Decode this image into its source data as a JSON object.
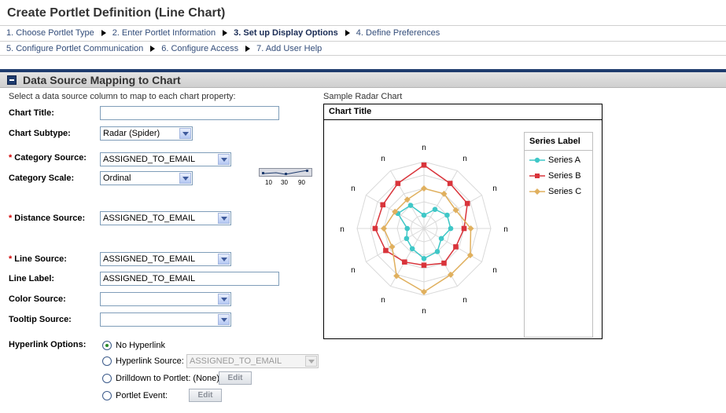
{
  "page": {
    "title": "Create Portlet Definition (Line Chart)"
  },
  "steps": [
    {
      "label": "1. Choose Portlet Type",
      "current": false
    },
    {
      "label": "2. Enter Portlet Information",
      "current": false
    },
    {
      "label": "3. Set up Display Options",
      "current": true
    },
    {
      "label": "4. Define Preferences",
      "current": false
    },
    {
      "label": "5. Configure Portlet Communication",
      "current": false
    },
    {
      "label": "6. Configure Access",
      "current": false
    },
    {
      "label": "7. Add User Help",
      "current": false
    }
  ],
  "section": {
    "title": "Data Source Mapping to Chart",
    "instructions": "Select a data source column to map to each chart property:",
    "sample_label": "Sample Radar Chart"
  },
  "form": {
    "chart_title": {
      "label": "Chart Title:",
      "value": ""
    },
    "chart_subtype": {
      "label": "Chart Subtype:",
      "value": "Radar (Spider)"
    },
    "category_source": {
      "label": "Category Source:",
      "value": "ASSIGNED_TO_EMAIL",
      "required_mark": "*"
    },
    "category_scale": {
      "label": "Category Scale:",
      "value": "Ordinal",
      "ticks": [
        "10",
        "30",
        "90"
      ]
    },
    "distance_source": {
      "label": "Distance Source:",
      "value": "ASSIGNED_TO_EMAIL",
      "required_mark": "*"
    },
    "line_source": {
      "label": "Line Source:",
      "value": "ASSIGNED_TO_EMAIL",
      "required_mark": "*"
    },
    "line_label": {
      "label": "Line Label:",
      "value": "ASSIGNED_TO_EMAIL"
    },
    "color_source": {
      "label": "Color Source:",
      "value": ""
    },
    "tooltip_source": {
      "label": "Tooltip Source:",
      "value": ""
    },
    "hyperlink": {
      "label": "Hyperlink Options:",
      "no_hyperlink": "No Hyperlink",
      "hyperlink_source": "Hyperlink Source:",
      "hyperlink_source_value": "ASSIGNED_TO_EMAIL",
      "drilldown": "Drilldown to Portlet: (None)",
      "portlet_event": "Portlet Event:",
      "edit_label": "Edit",
      "selected": "no_hyperlink"
    }
  },
  "chart_data": {
    "type": "radar",
    "title": "Chart Title",
    "legend_title": "Series Label",
    "legend_placement": "right",
    "axis_label": "n",
    "axes_count": 12,
    "rmax": 1,
    "grid": true,
    "series": [
      {
        "name": "Series A",
        "color": "#3fc7c7",
        "marker": "circle",
        "values": [
          0.2,
          0.33,
          0.4,
          0.4,
          0.3,
          0.4,
          0.45,
          0.35,
          0.3,
          0.25,
          0.45,
          0.4
        ]
      },
      {
        "name": "Series B",
        "color": "#d9343b",
        "marker": "square",
        "values": [
          0.95,
          0.78,
          0.75,
          0.6,
          0.55,
          0.6,
          0.55,
          0.58,
          0.66,
          0.73,
          0.71,
          0.78
        ]
      },
      {
        "name": "Series C",
        "color": "#e0b05e",
        "marker": "diamond",
        "values": [
          0.6,
          0.6,
          0.55,
          0.7,
          0.8,
          0.8,
          0.95,
          0.82,
          0.55,
          0.6,
          0.5,
          0.5
        ]
      }
    ]
  },
  "colors": {
    "accent": "#1f3c6e",
    "required": "#d00000",
    "link": "#334d7a"
  }
}
